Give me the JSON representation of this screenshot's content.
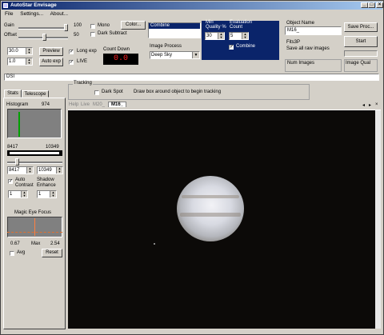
{
  "window": {
    "title": "AutoStar Envisage"
  },
  "menu": [
    "File",
    "Settings...",
    "About..."
  ],
  "gain": {
    "label": "Gain",
    "value": "100"
  },
  "offset": {
    "label": "Offset",
    "value": "50"
  },
  "mono": {
    "label": "Mono",
    "checked": false
  },
  "dark_subtract": {
    "label": "Dark Subtract",
    "checked": false
  },
  "color_button": "Color...",
  "exposure": {
    "value": "30.0",
    "count": "1.0",
    "preview_button": "Preview",
    "auto_exp_button": "Auto exp"
  },
  "long_exp": {
    "label": "Long exp",
    "checked": true
  },
  "live": {
    "label": "LIVE",
    "checked": true
  },
  "count_down": {
    "label": "Count Down",
    "value": "0.0"
  },
  "combine_list": {
    "selected": "Combine"
  },
  "image_process": {
    "label": "Image Process",
    "value": "Deep Sky"
  },
  "quality": {
    "min_label": "Min",
    "quality_label": "Quality %",
    "value": "30"
  },
  "evaluation": {
    "label": "Evaluation",
    "count_label": "Count",
    "value": "5"
  },
  "combine_check": {
    "label": "Combine",
    "checked": true
  },
  "object_name": {
    "label": "Object Name",
    "value": "M16_"
  },
  "save_proc_button": "Save Proc...",
  "start_button": "Start",
  "fits3p": {
    "label": "Fits3P",
    "sub": "Save all raw images"
  },
  "num_images": {
    "label": "Num Images"
  },
  "image_qual": {
    "label": "Image Qual"
  },
  "dsi": {
    "label": "DSI"
  },
  "left_tabs": [
    "Stats",
    "Telescope"
  ],
  "histogram": {
    "label": "Histogram",
    "value": "974"
  },
  "range": {
    "min": "8417",
    "max": "10349",
    "min_input": "8417",
    "max_input": "10349"
  },
  "auto_contrast": {
    "label": "Auto Contrast",
    "checked": true,
    "value": "1"
  },
  "shadow_enhance": {
    "label": "Shadow Enhance",
    "value": "1"
  },
  "magic_eye": {
    "label": "Magic Eye Focus"
  },
  "focus_stats": {
    "min": "0.67",
    "max_label": "Max",
    "max": "2.54"
  },
  "avg": {
    "label": "Avg",
    "checked": false
  },
  "reset_button": "Reset",
  "tracking": {
    "label": "Tracking",
    "dark_spot_label": "Dark Spot",
    "hint": "Draw box around object to begin tracking"
  },
  "image_tabs": [
    "Help",
    "Live",
    "M20_",
    "M16_"
  ],
  "colors": {
    "title_start": "#0a246a",
    "count_down_bg": "#000000",
    "count_down_text": "#ff2020",
    "accent_blue": "#0a246a"
  }
}
